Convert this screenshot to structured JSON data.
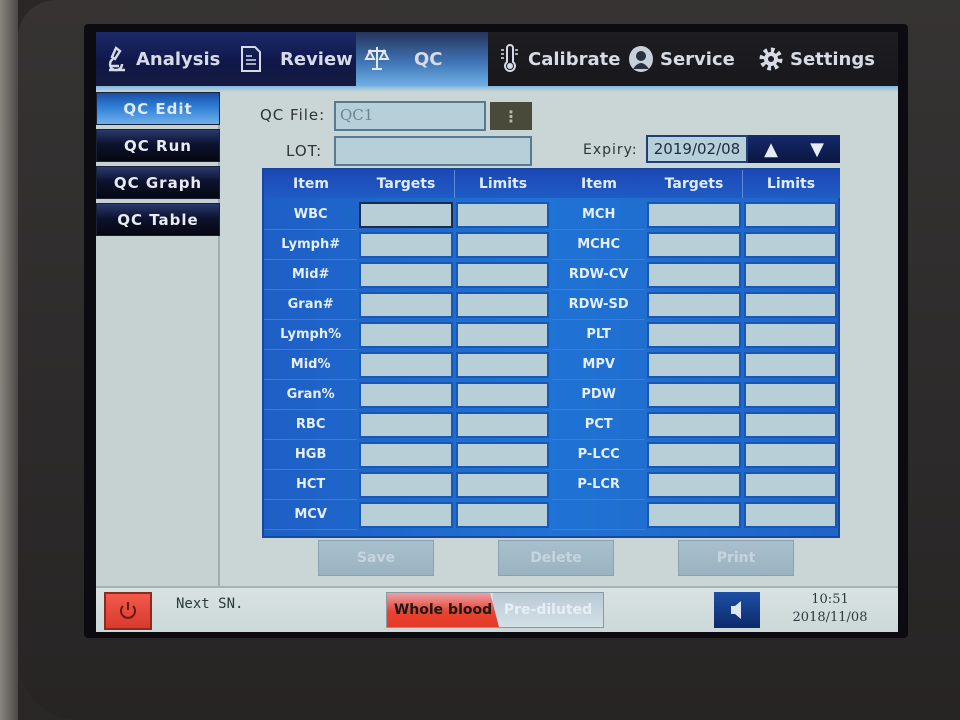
{
  "topnav": {
    "items": [
      {
        "label": "Analysis",
        "icon": "microscope-icon",
        "active": false
      },
      {
        "label": "Review",
        "icon": "document-icon",
        "active": false
      },
      {
        "label": "QC",
        "icon": "scales-icon",
        "active": true
      },
      {
        "label": "Calibrate",
        "icon": "thermometer-icon",
        "active": false
      },
      {
        "label": "Service",
        "icon": "person-icon",
        "active": false
      },
      {
        "label": "Settings",
        "icon": "gear-icon",
        "active": false
      }
    ]
  },
  "leftmenu": {
    "items": [
      {
        "label": "QC Edit",
        "active": true
      },
      {
        "label": "QC Run",
        "active": false
      },
      {
        "label": "QC Graph",
        "active": false
      },
      {
        "label": "QC Table",
        "active": false
      }
    ]
  },
  "form": {
    "qc_file_label": "QC File:",
    "qc_file_value": "QC1",
    "more_label": "⋮",
    "lot_label": "LOT:",
    "lot_value": "",
    "expiry_label": "Expiry:",
    "expiry_value": "2019/02/08",
    "up_label": "▲",
    "down_label": "▼"
  },
  "table": {
    "headers": {
      "item": "Item",
      "targets": "Targets",
      "limits": "Limits"
    },
    "left_items": [
      "WBC",
      "Lymph#",
      "Mid#",
      "Gran#",
      "Lymph%",
      "Mid%",
      "Gran%",
      "RBC",
      "HGB",
      "HCT",
      "MCV"
    ],
    "right_items": [
      "MCH",
      "MCHC",
      "RDW-CV",
      "RDW-SD",
      "PLT",
      "MPV",
      "PDW",
      "PCT",
      "P-LCC",
      "P-LCR",
      ""
    ]
  },
  "actions": {
    "save": "Save",
    "delete": "Delete",
    "print": "Print"
  },
  "statusbar": {
    "next_sn_label": "Next SN.",
    "mode_whole_blood": "Whole blood",
    "mode_prediluted": "Pre-diluted",
    "selected_mode": "Whole blood",
    "time": "10:51",
    "date": "2018/11/08"
  },
  "colors": {
    "accent_blue": "#1f6fd0",
    "active_mode_red": "#e5392a",
    "nav_dark": "#10184a"
  }
}
